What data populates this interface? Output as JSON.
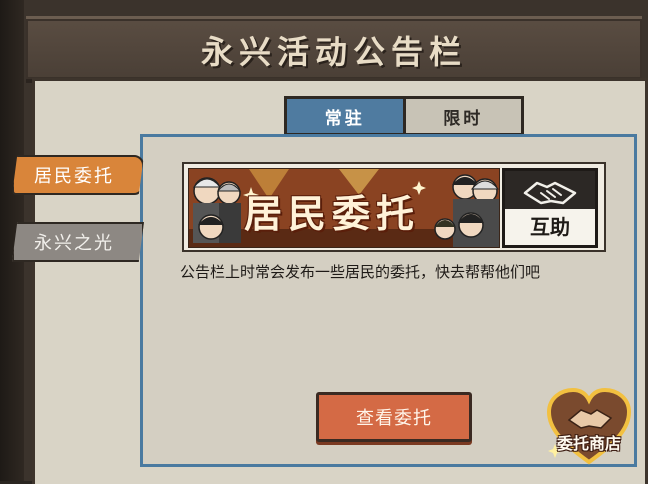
{
  "header": {
    "title": "永兴活动公告栏"
  },
  "tabs": [
    {
      "label": "常驻",
      "active": true
    },
    {
      "label": "限时",
      "active": false
    }
  ],
  "sidebar": {
    "items": [
      {
        "label": "居民委托",
        "active": true
      },
      {
        "label": "永兴之光",
        "active": false
      }
    ]
  },
  "banner": {
    "title": "居民委托",
    "help_label": "互助"
  },
  "description": "公告栏上时常会发布一些居民的委托，快去帮帮他们吧",
  "actions": {
    "view_label": "查看委托"
  },
  "shop": {
    "label": "委托商店"
  },
  "colors": {
    "accent_blue": "#4f7ba0",
    "accent_orange": "#d9853a",
    "button_orange": "#d46a45",
    "panel_bg": "#d9d4c6"
  }
}
